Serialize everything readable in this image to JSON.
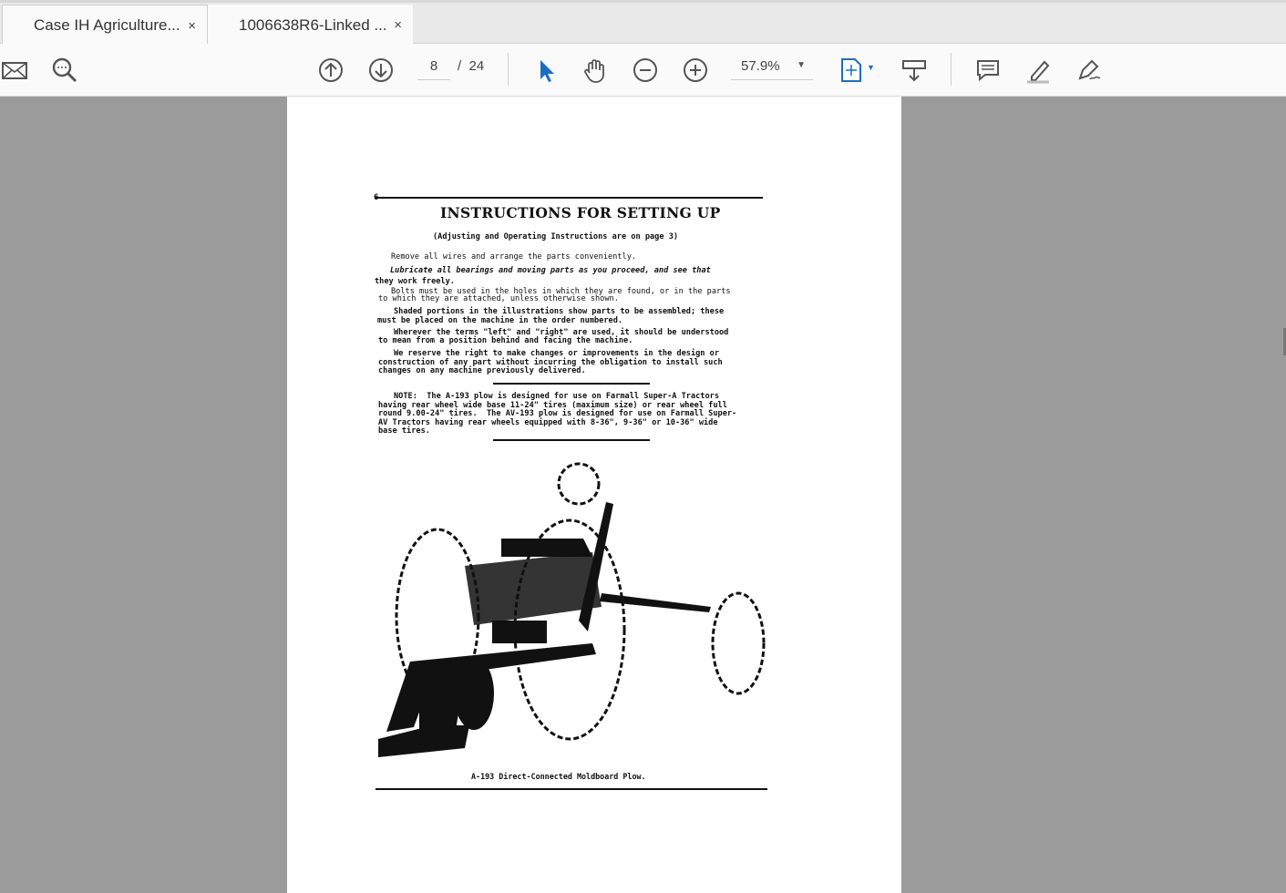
{
  "tabs": [
    {
      "label": "Case IH Agriculture...",
      "close": "×"
    },
    {
      "label": "1006638R6-Linked ...",
      "close": "×"
    }
  ],
  "toolbar": {
    "page_current": "8",
    "page_sep": "/",
    "page_total": "24",
    "zoom": "57.9%"
  },
  "colors": {
    "accent": "#1a6fc4",
    "icon": "#555555"
  },
  "doc": {
    "page_number": "6",
    "title": "INSTRUCTIONS FOR SETTING UP",
    "subtitle": "(Adjusting and Operating Instructions are on page 3)",
    "p1": "Remove all wires and arrange the parts conveniently.",
    "p2a": "Lubricate all bearings and moving parts as you proceed, and see that",
    "p2b": "they work freely.",
    "p3a": "Bolts must be used in the holes in which they are found, or in the parts",
    "p3b": "to which they are attached, unless otherwise shown.",
    "p4a": "Shaded portions in the illustrations show parts to be assembled; these",
    "p4b": "must be placed on the machine in the order numbered.",
    "p5a": "Wherever the terms \"left\" and \"right\" are used, it should be understood",
    "p5b": "to mean from a position behind and facing the machine.",
    "p6a": "We reserve the right to make changes or improvements in the design or",
    "p6b": "construction of any part without incurring the obligation to install such",
    "p6c": "changes on any machine previously delivered.",
    "note1": "NOTE:  The A-193 plow is designed for use on Farmall Super-A Tractors",
    "note2": "having rear wheel wide base 11-24\" tires (maximum size) or rear wheel full",
    "note3": "round 9.00-24\" tires.  The AV-193 plow is designed for use on Farmall Super-",
    "note4": "AV Tractors having rear wheels equipped with 8-36\", 9-36\" or 10-36\" wide",
    "note5": "base tires.",
    "caption": "A-193 Direct-Connected Moldboard Plow."
  }
}
